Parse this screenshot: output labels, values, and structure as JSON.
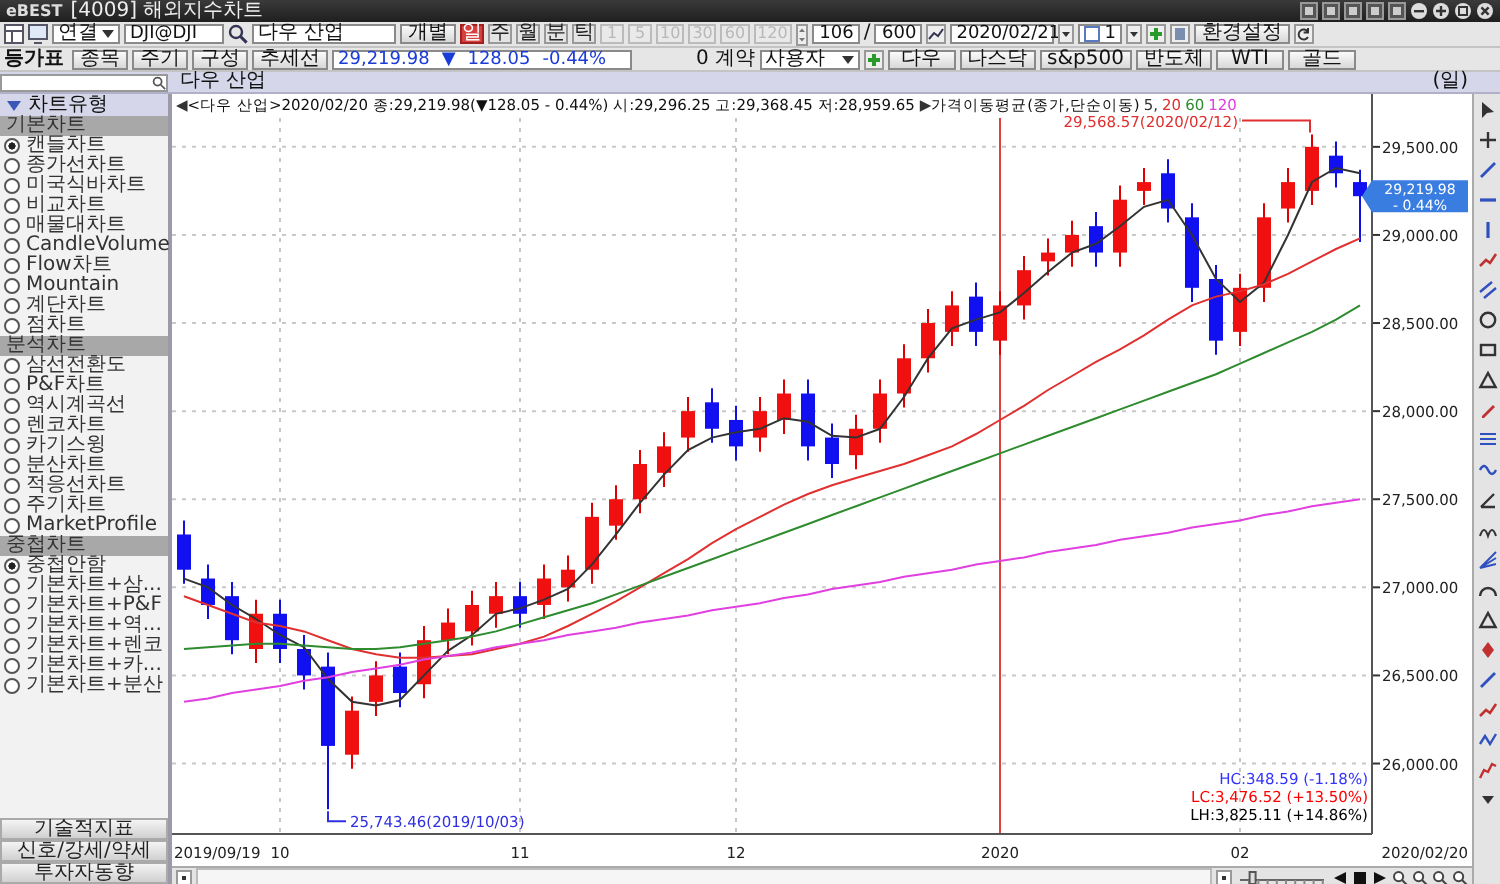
{
  "window": {
    "logo": "eBEST",
    "title": "[4009] 해외지수차트"
  },
  "toolbar": {
    "link_select": "연결",
    "symbol_code": "DJI@DJI",
    "symbol_name": "다우 산업",
    "individual_button": "개별",
    "periods": [
      {
        "label": "일",
        "selected": true
      },
      {
        "label": "주",
        "selected": false
      },
      {
        "label": "월",
        "selected": false
      },
      {
        "label": "분",
        "selected": false
      },
      {
        "label": "틱",
        "selected": false
      }
    ],
    "intervals": [
      {
        "label": "1",
        "disabled": true
      },
      {
        "label": "5",
        "disabled": true
      },
      {
        "label": "10",
        "disabled": true
      },
      {
        "label": "30",
        "disabled": true
      },
      {
        "label": "60",
        "disabled": true
      },
      {
        "label": "120",
        "disabled": true
      }
    ],
    "count": "106",
    "separator": "/",
    "max_count": "600",
    "date": "2020/02/21",
    "multiplier": "1",
    "settings_button": "환경설정"
  },
  "toolbar2": {
    "title": "등가표",
    "buttons": [
      "종목",
      "주기",
      "구성",
      "추세선"
    ],
    "price": "29,219.98",
    "change_arrow": "▼",
    "change": "128.05",
    "change_pct": "-0.44%",
    "contracts": "0 계약",
    "user_select": "사용자",
    "quick_buttons": [
      "다우",
      "나스닥",
      "s&p500",
      "반도체",
      "WTI",
      "골드"
    ]
  },
  "sidebar": {
    "header": "차트유형",
    "sections": [
      {
        "title": "기본차트",
        "items": [
          {
            "label": "캔들차트",
            "selected": true
          },
          {
            "label": "종가선차트",
            "selected": false
          },
          {
            "label": "미국식바차트",
            "selected": false
          },
          {
            "label": "비교차트",
            "selected": false
          },
          {
            "label": "매물대차트",
            "selected": false
          },
          {
            "label": "CandleVolume",
            "selected": false
          },
          {
            "label": "Flow차트",
            "selected": false
          },
          {
            "label": "Mountain",
            "selected": false
          },
          {
            "label": "계단차트",
            "selected": false
          },
          {
            "label": "점차트",
            "selected": false
          }
        ]
      },
      {
        "title": "분석차트",
        "items": [
          {
            "label": "삼선전환도",
            "selected": false
          },
          {
            "label": "P&F차트",
            "selected": false
          },
          {
            "label": "역시계곡선",
            "selected": false
          },
          {
            "label": "렌코차트",
            "selected": false
          },
          {
            "label": "카기스윙",
            "selected": false
          },
          {
            "label": "분산차트",
            "selected": false
          },
          {
            "label": "적응선차트",
            "selected": false
          },
          {
            "label": "주기차트",
            "selected": false
          },
          {
            "label": "MarketProfile",
            "selected": false
          }
        ]
      },
      {
        "title": "중첩차트",
        "items": [
          {
            "label": "중첩안함",
            "selected": true
          },
          {
            "label": "기본차트+삼...",
            "selected": false
          },
          {
            "label": "기본차트+P&F",
            "selected": false
          },
          {
            "label": "기본차트+역...",
            "selected": false
          },
          {
            "label": "기본차트+렌코",
            "selected": false
          },
          {
            "label": "기본차트+카...",
            "selected": false
          },
          {
            "label": "기본차트+분산",
            "selected": false
          }
        ]
      }
    ],
    "bottom_buttons": [
      "기술적지표",
      "신호/강세/약세",
      "투자자동향"
    ]
  },
  "chart_panel": {
    "title": "다우 산업",
    "period_label": "(일)",
    "info_prefix": "◀",
    "info": "<다우 산업>2020/02/20 종:29,219.98(▼128.05 - 0.44%) 시:29,296.25 고:29,368.45 저:28,959.65",
    "ma_prefix": "▶",
    "ma_label": "가격이동평균(종가,단순이동)",
    "range_start": "2019/09/19",
    "range_end": "2020/02/20",
    "chart_data": {
      "type": "candlestick",
      "grid": true,
      "ylim": [
        25600,
        29800
      ],
      "categories": [
        null,
        null,
        null,
        null,
        "10",
        null,
        null,
        null,
        null,
        null,
        null,
        null,
        null,
        null,
        "11",
        null,
        null,
        null,
        null,
        null,
        null,
        null,
        null,
        "12",
        null,
        null,
        null,
        null,
        null,
        null,
        null,
        null,
        null,
        null,
        "2020",
        null,
        null,
        null,
        null,
        null,
        null,
        null,
        null,
        null,
        "02",
        null,
        null,
        null,
        null,
        null
      ],
      "ohlc": [
        [
          27300,
          27380,
          27020,
          27100
        ],
        [
          27050,
          27130,
          26820,
          26900
        ],
        [
          26950,
          27030,
          26620,
          26700
        ],
        [
          26650,
          26930,
          26570,
          26850
        ],
        [
          26850,
          26930,
          26570,
          26650
        ],
        [
          26650,
          26730,
          26420,
          26500
        ],
        [
          26550,
          26630,
          25740,
          26100
        ],
        [
          26050,
          26380,
          25970,
          26300
        ],
        [
          26350,
          26580,
          26270,
          26500
        ],
        [
          26550,
          26630,
          26320,
          26400
        ],
        [
          26450,
          26780,
          26370,
          26700
        ],
        [
          26700,
          26880,
          26620,
          26800
        ],
        [
          26750,
          26980,
          26670,
          26900
        ],
        [
          26850,
          27030,
          26770,
          26950
        ],
        [
          26950,
          27030,
          26770,
          26850
        ],
        [
          26900,
          27130,
          26820,
          27050
        ],
        [
          27000,
          27180,
          26920,
          27100
        ],
        [
          27100,
          27480,
          27020,
          27400
        ],
        [
          27350,
          27580,
          27270,
          27500
        ],
        [
          27500,
          27780,
          27420,
          27700
        ],
        [
          27650,
          27880,
          27570,
          27800
        ],
        [
          27850,
          28080,
          27770,
          28000
        ],
        [
          28050,
          28130,
          27820,
          27900
        ],
        [
          27950,
          28030,
          27720,
          27800
        ],
        [
          27850,
          28080,
          27770,
          28000
        ],
        [
          27950,
          28180,
          27870,
          28100
        ],
        [
          28100,
          28180,
          27720,
          27800
        ],
        [
          27850,
          27930,
          27620,
          27700
        ],
        [
          27750,
          27980,
          27670,
          27900
        ],
        [
          27900,
          28180,
          27820,
          28100
        ],
        [
          28100,
          28380,
          28020,
          28300
        ],
        [
          28300,
          28580,
          28220,
          28500
        ],
        [
          28450,
          28680,
          28370,
          28600
        ],
        [
          28650,
          28730,
          28370,
          28450
        ],
        [
          28400,
          28680,
          28320,
          28600
        ],
        [
          28600,
          28880,
          28520,
          28800
        ],
        [
          28850,
          28980,
          28770,
          28900
        ],
        [
          28900,
          29080,
          28820,
          29000
        ],
        [
          29050,
          29130,
          28820,
          28900
        ],
        [
          28900,
          29280,
          28820,
          29200
        ],
        [
          29250,
          29380,
          29170,
          29300
        ],
        [
          29350,
          29430,
          29070,
          29150
        ],
        [
          29100,
          29180,
          28620,
          28700
        ],
        [
          28750,
          28830,
          28320,
          28400
        ],
        [
          28450,
          28780,
          28370,
          28700
        ],
        [
          28700,
          29180,
          28620,
          29100
        ],
        [
          29150,
          29380,
          29070,
          29300
        ],
        [
          29250,
          29570,
          29170,
          29500
        ],
        [
          29450,
          29530,
          29270,
          29350
        ],
        [
          29300,
          29370,
          28960,
          29220
        ]
      ],
      "yticks": [
        {
          "value": 29500,
          "label": "29,500.00"
        },
        {
          "value": 29000,
          "label": "29,000.00"
        },
        {
          "value": 28500,
          "label": "28,500.00"
        },
        {
          "value": 28000,
          "label": "28,000.00"
        },
        {
          "value": 27500,
          "label": "27,500.00"
        },
        {
          "value": 27000,
          "label": "27,000.00"
        },
        {
          "value": 26500,
          "label": "26,500.00"
        },
        {
          "value": 26000,
          "label": "26,000.00"
        }
      ],
      "series": [
        {
          "name": "5,",
          "type": "line",
          "color": "#333333",
          "values": [
            27050,
            27000,
            26900,
            26820,
            26730,
            26660,
            26480,
            26350,
            26330,
            26360,
            26500,
            26640,
            26730,
            26850,
            26880,
            26930,
            26990,
            27130,
            27300,
            27480,
            27640,
            27780,
            27850,
            27880,
            27900,
            27960,
            27940,
            27860,
            27850,
            27900,
            28080,
            28300,
            28470,
            28520,
            28560,
            28670,
            28790,
            28900,
            28950,
            29050,
            29160,
            29200,
            29000,
            28750,
            28620,
            28730,
            29000,
            29300,
            29380,
            29350
          ]
        },
        {
          "name": "20",
          "type": "line",
          "color": "#e03030",
          "values": [
            26950,
            26900,
            26850,
            26800,
            26780,
            26750,
            26700,
            26650,
            26620,
            26600,
            26600,
            26610,
            26620,
            26650,
            26680,
            26720,
            26780,
            26850,
            26920,
            27000,
            27080,
            27160,
            27250,
            27330,
            27400,
            27470,
            27530,
            27580,
            27620,
            27660,
            27700,
            27750,
            27800,
            27870,
            27950,
            28030,
            28120,
            28200,
            28280,
            28350,
            28430,
            28520,
            28600,
            28650,
            28680,
            28720,
            28780,
            28850,
            28920,
            28980
          ]
        },
        {
          "name": "60",
          "type": "line",
          "color": "#2e8b2e",
          "values": [
            26650,
            26660,
            26670,
            26680,
            26680,
            26670,
            26660,
            26650,
            26650,
            26660,
            26680,
            26700,
            26720,
            26750,
            26790,
            26830,
            26870,
            26910,
            26960,
            27010,
            27060,
            27110,
            27160,
            27210,
            27260,
            27310,
            27360,
            27410,
            27460,
            27510,
            27560,
            27610,
            27660,
            27710,
            27760,
            27810,
            27860,
            27910,
            27960,
            28010,
            28060,
            28110,
            28160,
            28210,
            28270,
            28330,
            28390,
            28450,
            28520,
            28600
          ]
        },
        {
          "name": "120",
          "type": "line",
          "color": "#e040e0",
          "values": [
            26350,
            26370,
            26400,
            26420,
            26440,
            26470,
            26490,
            26520,
            26540,
            26560,
            26590,
            26610,
            26630,
            26660,
            26680,
            26700,
            26730,
            26750,
            26770,
            26800,
            26820,
            26840,
            26870,
            26890,
            26910,
            26940,
            26960,
            26990,
            27010,
            27030,
            27060,
            27080,
            27100,
            27130,
            27150,
            27170,
            27200,
            27220,
            27240,
            27270,
            27290,
            27310,
            27340,
            27360,
            27380,
            27410,
            27430,
            27460,
            27480,
            27500
          ]
        }
      ],
      "annotations": [
        "29,568.57(2020/02/12)",
        "25,743.46(2019/10/03)"
      ]
    },
    "last_price": {
      "price": "29,219.98",
      "change": "- 0.44%"
    },
    "stats": [
      {
        "text": "HC:348.59 (-1.18%)",
        "color": "#3333ff"
      },
      {
        "text": "LC:3,476.52 (+13.50%)",
        "color": "#ff0000"
      },
      {
        "text": "LH:3,825.11 (+14.86%)",
        "color": "#000000"
      }
    ]
  }
}
